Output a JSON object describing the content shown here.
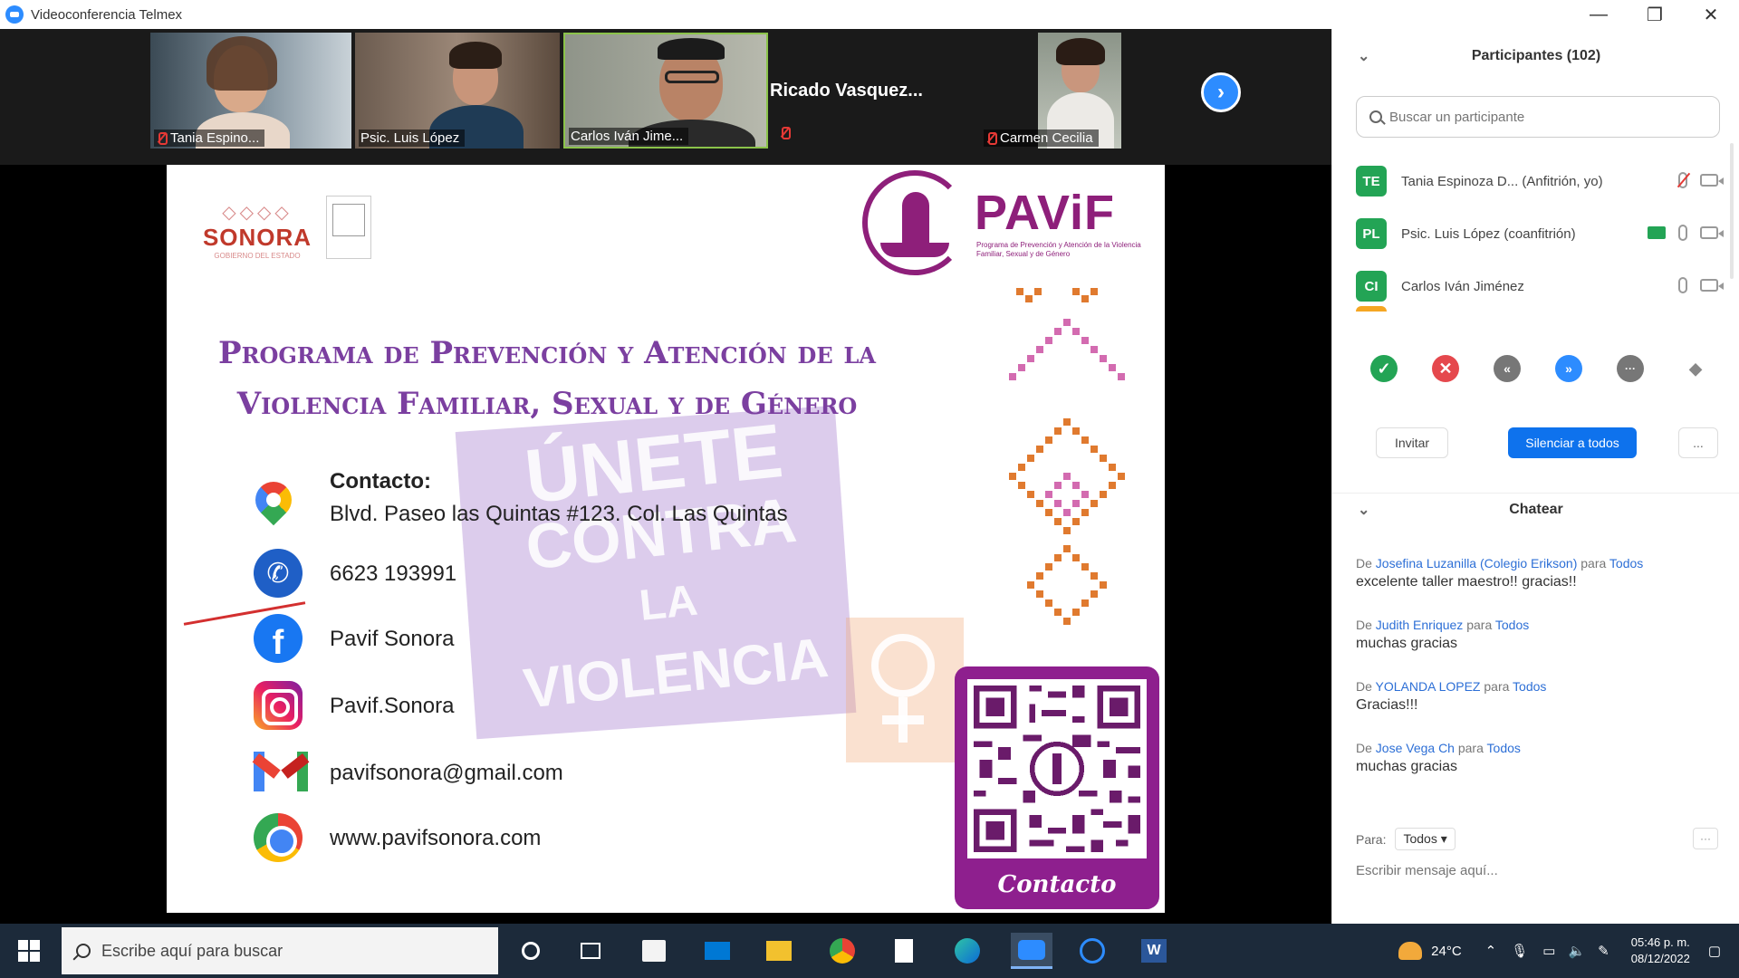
{
  "window": {
    "title": "Videoconferencia Telmex",
    "minimize": "—",
    "restore": "❐",
    "close": "✕"
  },
  "video_strip": {
    "tiles": [
      {
        "name": "Tania Espino..."
      },
      {
        "name": "Psic. Luis López"
      },
      {
        "name": "Carlos Iván Jime..."
      },
      {
        "name": "Ricado  Vasquez..."
      },
      {
        "name": "Carmen Cecilia"
      }
    ],
    "next_icon": "›"
  },
  "slide": {
    "sonora_deco": "◇◇◇◇",
    "sonora_word": "SONORA",
    "sonora_sub": "GOBIERNO DEL ESTADO",
    "pavif_word": "PAViF",
    "pavif_sub": "Programa de Prevención y Atención de la Violencia Familiar, Sexual y de Género",
    "title_line1": "Programa de Prevención y Atención de la",
    "title_line2": "Violencia Familiar, Sexual y de Género",
    "watermark": [
      "ÚNETE",
      "CONTRA",
      "LA",
      "VIOLENCIA"
    ],
    "contact_heading": "Contacto:",
    "address": "Blvd. Paseo las Quintas #123. Col. Las Quintas",
    "phone": "6623 193991",
    "facebook": "Pavif Sonora",
    "instagram": "Pavif.Sonora",
    "email": "pavifsonora@gmail.com",
    "website": "www.pavifsonora.com",
    "qr_label": "Contacto",
    "phone_icon": "✆",
    "facebook_icon": "f"
  },
  "participants": {
    "header": "Participantes (102)",
    "collapse_icon": "⌄",
    "search_placeholder": "Buscar un participante",
    "list": [
      {
        "initials": "TE",
        "name": "Tania Espinoza D...  (Anfitrión, yo)",
        "color": "#23a455"
      },
      {
        "initials": "PL",
        "name": "Psic. Luis López (coanfitrión)",
        "color": "#23a455"
      },
      {
        "initials": "CI",
        "name": "Carlos Iván Jiménez",
        "color": "#23a455"
      }
    ],
    "reactions": [
      "✓",
      "✕",
      "«",
      "»",
      "···",
      "◆"
    ],
    "invite_label": "Invitar",
    "mute_all_label": "Silenciar a todos",
    "more_label": "..."
  },
  "chat": {
    "header": "Chatear",
    "messages": [
      {
        "prefix": "De",
        "from": "Josefina Luzanilla (Colegio Erikson)",
        "to_word": "para",
        "to": "Todos",
        "text": "excelente taller maestro!! gracias!!"
      },
      {
        "prefix": "De",
        "from": "Judith Enriquez",
        "to_word": "para",
        "to": "Todos",
        "text": "muchas gracias"
      },
      {
        "prefix": "De",
        "from": "YOLANDA LOPEZ",
        "to_word": "para",
        "to": "Todos",
        "text": "Gracias!!!"
      },
      {
        "prefix": "De",
        "from": "Jose Vega Ch",
        "to_word": "para",
        "to": "Todos",
        "text": "muchas gracias"
      }
    ],
    "to_label": "Para:",
    "to_value": "Todos ▾",
    "more": "···",
    "input_placeholder": "Escribir mensaje aquí..."
  },
  "taskbar": {
    "search_placeholder": "Escribe aquí para buscar",
    "temperature": "24°C",
    "time": "05:46 p. m.",
    "date": "08/12/2022",
    "colors": {
      "background": "#1c2a3a",
      "zoom_blue": "#2d8cff",
      "pavif_purple": "#8e1f7a"
    }
  }
}
